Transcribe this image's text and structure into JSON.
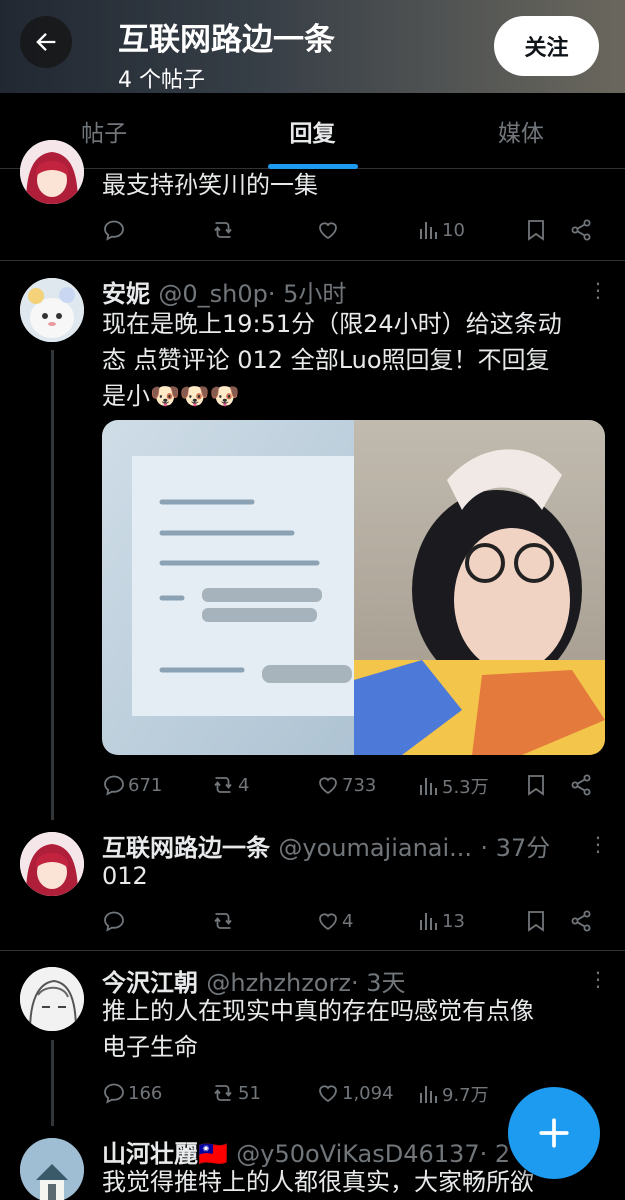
{
  "header": {
    "title": "互联网路边一条",
    "post_count": "4 个帖子",
    "follow_label": "关注"
  },
  "tabs": [
    {
      "label": "帖子"
    },
    {
      "label": "回复"
    },
    {
      "label": "媒体"
    }
  ],
  "posts": [
    {
      "text": "最支持孙笑川的一集",
      "views": "10"
    },
    {
      "name": "安妮",
      "handle": "@0_sh0p",
      "time": "· 5小时",
      "text_line1": "现在是晚上19:51分（限24小时）给这条动",
      "text_line2": "态 点赞评论 012 全部Luo照回复！不回复",
      "text_line3": "是小🐶🐶🐶",
      "replies": "671",
      "reposts": "4",
      "likes": "733",
      "views": "5.3万"
    },
    {
      "name": "互联网路边一条",
      "handle": "@youmajianai...",
      "time": "· 37分",
      "text": "012",
      "likes": "4",
      "views": "13"
    },
    {
      "name": "今沢江朝",
      "handle": "@hzhzhzorz",
      "time": "· 3天",
      "text_line1": "推上的人在现实中真的存在吗感觉有点像",
      "text_line2": "电子生命",
      "replies": "166",
      "reposts": "51",
      "likes": "1,094",
      "views": "9.7万"
    },
    {
      "name": "山河壮麗🇹🇼",
      "handle": "@y50oViKasD46137",
      "time": "· 2",
      "text": "我觉得推特上的人都很真实，大家畅所欲"
    }
  ],
  "colors": {
    "accent": "#1d9bf0",
    "muted": "#71767b",
    "background": "#000000"
  }
}
